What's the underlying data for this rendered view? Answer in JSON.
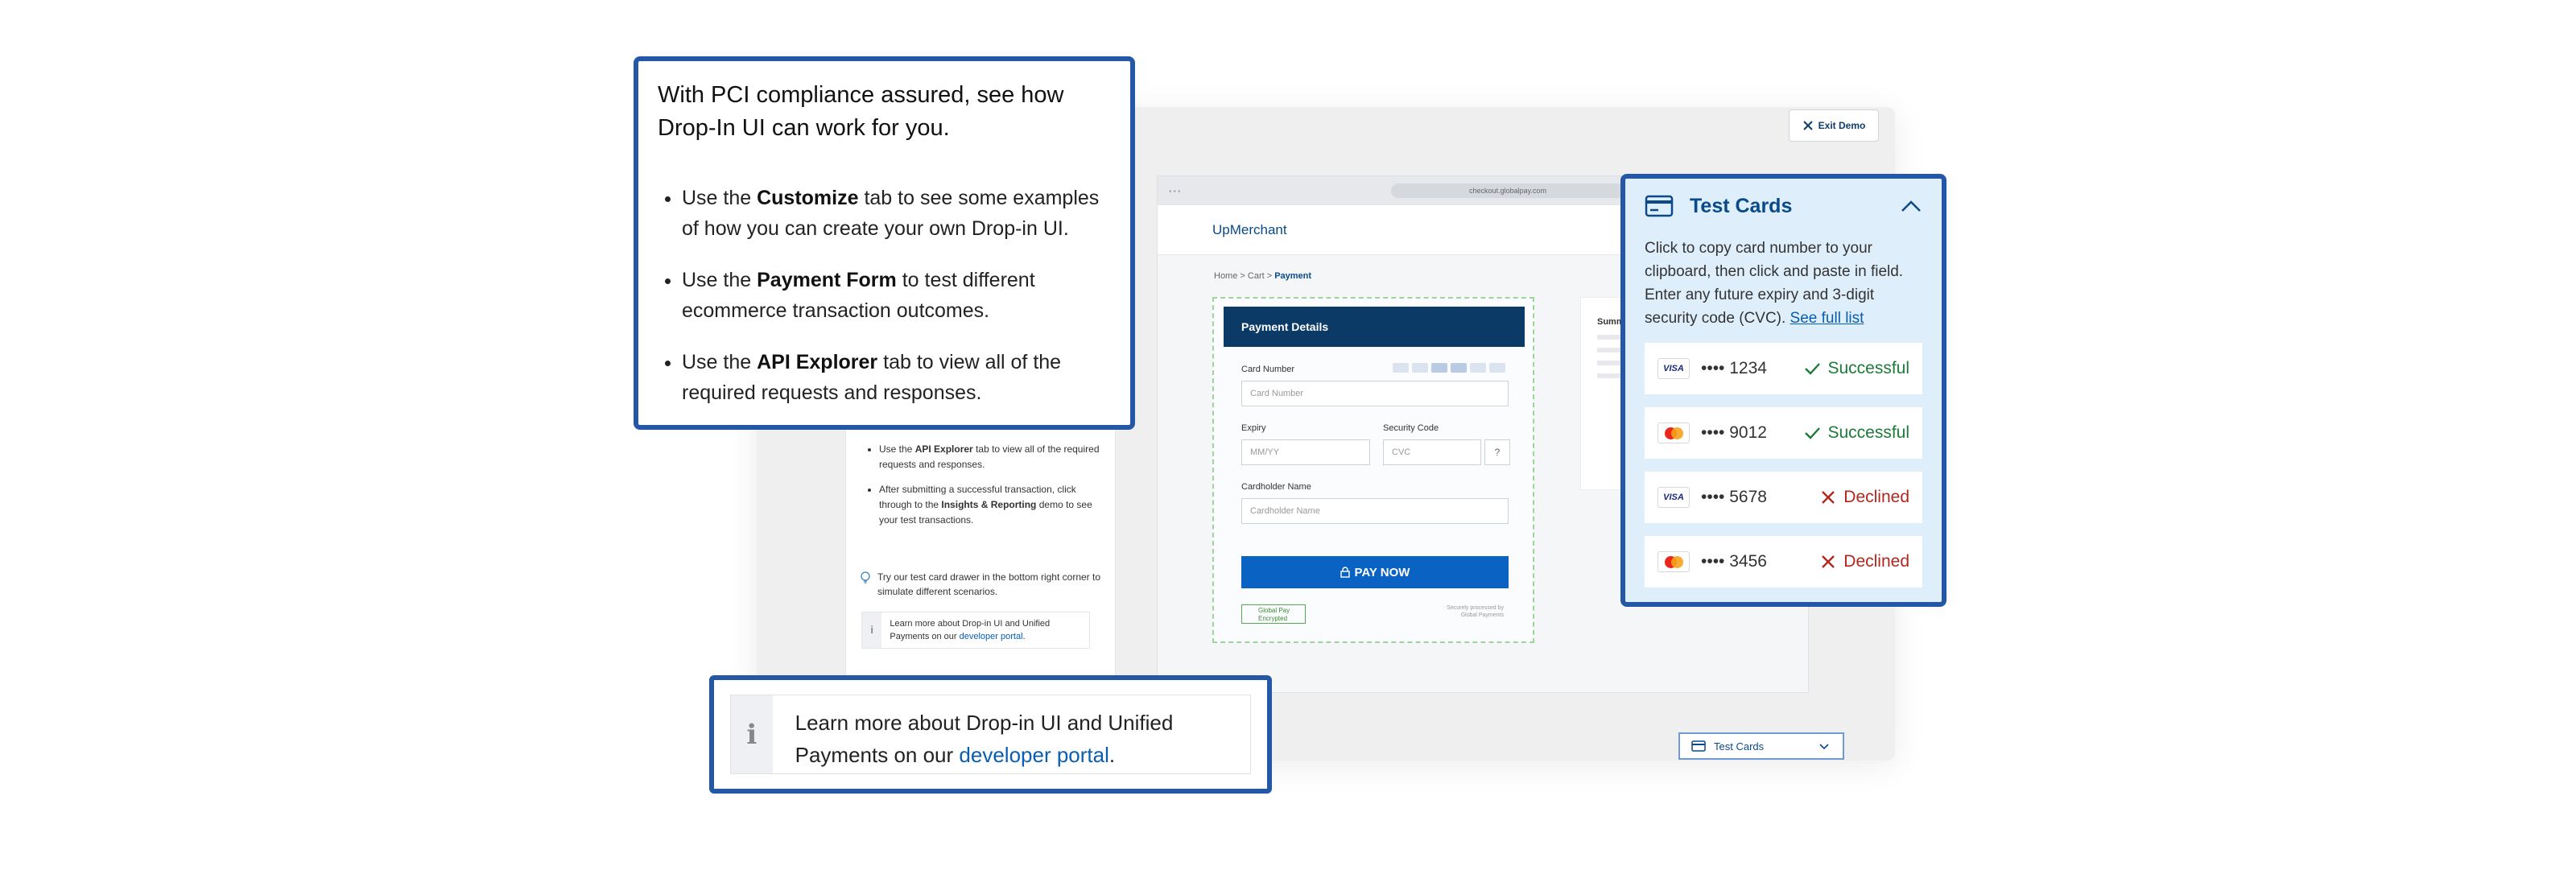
{
  "demo": {
    "exit_label": "Exit Demo"
  },
  "guide_panel": {
    "items": [
      {
        "pre": "Use the ",
        "bold": "API Explorer",
        "post": " tab to view all of the required requests and responses."
      },
      {
        "pre": "After submitting a successful transaction, click through to the ",
        "bold": "Insights & Reporting",
        "post": " demo to see your test transactions."
      }
    ],
    "tip": "Try our test card drawer in the bottom right corner to simulate different scenarios.",
    "info_pre": "Learn more about Drop-in UI and Unified Payments on our ",
    "info_link": "developer portal",
    "info_post": "."
  },
  "browser": {
    "url": "checkout.globalpay.com",
    "merchant": "UpMerchant",
    "breadcrumb_pre": "Home > Cart > ",
    "breadcrumb_current": "Payment",
    "payment_header": "Payment Details",
    "card_number_label": "Card Number",
    "card_number_placeholder": "Card Number",
    "expiry_label": "Expiry",
    "expiry_placeholder": "MM/YY",
    "security_label": "Security Code",
    "security_placeholder": "CVC",
    "holder_label": "Cardholder Name",
    "holder_placeholder": "Cardholder Name",
    "pay_label": "PAY NOW",
    "secure_badge": "Global Pay Encrypted",
    "powered_text": "Securely processed by Global Payments",
    "summary_title": "Summ",
    "test_cards_label": "Test Cards"
  },
  "callout_main": {
    "heading": "With PCI compliance assured, see how Drop-In UI can work for you.",
    "bullets": [
      {
        "pre": "Use the ",
        "bold": "Customize",
        "post": " tab to see some examples of how you can create your own Drop-in UI."
      },
      {
        "pre": "Use the ",
        "bold": "Payment Form",
        "post": " to test different ecommerce transaction outcomes."
      },
      {
        "pre": "Use the ",
        "bold": "API Explorer",
        "post": " tab to view all of the required requests and responses."
      }
    ]
  },
  "callout_bottom": {
    "icon": "i",
    "text_pre": "Learn more about Drop-in UI and Unified Payments on our ",
    "link": "developer portal",
    "text_post": "."
  },
  "test_cards": {
    "title": "Test Cards",
    "desc_pre": "Click to copy card number to your clipboard, then click and paste in field. Enter any future expiry and 3-digit security code (CVC). ",
    "desc_link": "See full list",
    "cards": [
      {
        "brand": "VISA",
        "masked": "•••• 1234",
        "status": "Successful"
      },
      {
        "brand": "Mastercard",
        "masked": "•••• 9012",
        "status": "Successful"
      },
      {
        "brand": "VISA",
        "masked": "•••• 5678",
        "status": "Declined"
      },
      {
        "brand": "Mastercard",
        "masked": "•••• 3456",
        "status": "Declined"
      }
    ],
    "colors": {
      "success": "#1d7a3a",
      "declined": "#b3261e",
      "accent": "#2458a6"
    }
  }
}
